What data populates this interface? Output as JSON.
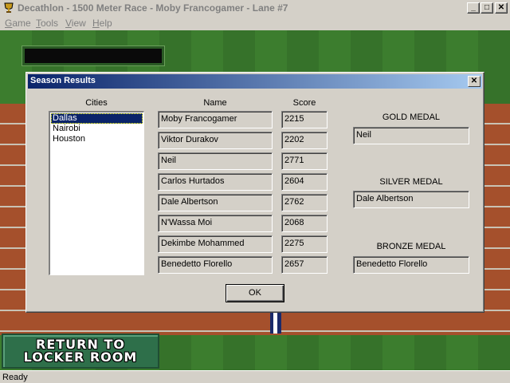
{
  "window": {
    "title": "Decathlon - 1500 Meter Race - Moby Francogamer - Lane #7",
    "minimize": "_",
    "maximize": "□",
    "close": "✕"
  },
  "menu": [
    {
      "first": "G",
      "rest": "ame"
    },
    {
      "first": "T",
      "rest": "ools"
    },
    {
      "first": "V",
      "rest": "iew"
    },
    {
      "first": "H",
      "rest": "elp"
    }
  ],
  "dialog": {
    "title": "Season Results",
    "close": "✕",
    "headers": {
      "cities": "Cities",
      "name": "Name",
      "score": "Score"
    },
    "cities": [
      "Dallas",
      "Nairobi",
      "Houston"
    ],
    "selected_city": "Dallas",
    "results": [
      {
        "name": "Moby Francogamer",
        "score": "2215"
      },
      {
        "name": "Viktor Durakov",
        "score": "2202"
      },
      {
        "name": "Neil",
        "score": "2771"
      },
      {
        "name": "Carlos Hurtados",
        "score": "2604"
      },
      {
        "name": "Dale Albertson",
        "score": "2762"
      },
      {
        "name": "N'Wassa Moi",
        "score": "2068"
      },
      {
        "name": "Dekimbe Mohammed",
        "score": "2275"
      },
      {
        "name": "Benedetto Florello",
        "score": "2657"
      }
    ],
    "medals": {
      "gold_label": "GOLD MEDAL",
      "gold": "Neil",
      "silver_label": "SILVER MEDAL",
      "silver": "Dale Albertson",
      "bronze_label": "BRONZE MEDAL",
      "bronze": "Benedetto Florello"
    },
    "ok_label": "OK"
  },
  "scene": {
    "locker_line1": "RETURN TO",
    "locker_line2": "LOCKER ROOM"
  },
  "status": "Ready"
}
